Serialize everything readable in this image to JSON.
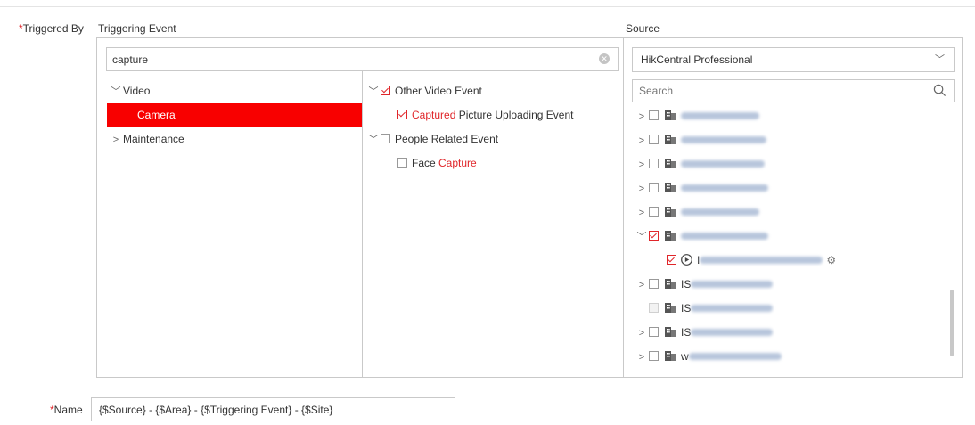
{
  "triggered_by_label": "Triggered By",
  "name_label": "Name",
  "required_mark": "*",
  "triggering_event": {
    "header": "Triggering Event",
    "search_value": "capture",
    "categories": [
      {
        "label": "Video",
        "expanded": true
      },
      {
        "label": "Camera",
        "selected": true
      },
      {
        "label": "Maintenance",
        "expanded": false
      }
    ],
    "events": [
      {
        "label": "Other Video Event",
        "checked": true
      },
      {
        "highlight": "Captured",
        "rest": " Picture Uploading Event",
        "checked": true
      },
      {
        "label": "People Related Event",
        "checked": false
      },
      {
        "prefix": "Face ",
        "highlight": "Capture",
        "checked": false
      }
    ]
  },
  "source": {
    "header": "Source",
    "dropdown_value": "HikCentral Professional",
    "search_placeholder": "Search",
    "items": [
      {
        "prefix": "",
        "checked": false
      },
      {
        "prefix": "",
        "checked": false
      },
      {
        "prefix": "",
        "checked": false
      },
      {
        "prefix": "",
        "checked": false
      },
      {
        "prefix": "",
        "checked": false
      },
      {
        "prefix": "",
        "checked": true,
        "expanded": true
      },
      {
        "prefix": "I",
        "checked": true,
        "child": true
      },
      {
        "prefix": "IS",
        "checked": false
      },
      {
        "prefix": "IS",
        "checked": false,
        "disabled": true
      },
      {
        "prefix": "IS",
        "checked": false
      },
      {
        "prefix": "w",
        "checked": false
      }
    ]
  },
  "name_value": "{$Source} - {$Area} - {$Triggering Event} - {$Site}",
  "colors": {
    "accent": "#e0262a",
    "selected_bg": "#f80000",
    "border": "#c9c9c9"
  }
}
